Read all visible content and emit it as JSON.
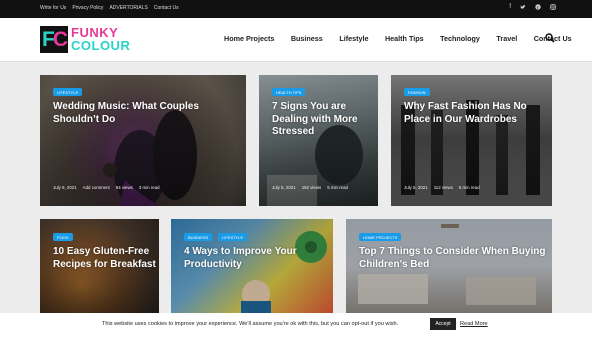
{
  "topbar": {
    "links": [
      "Write for Us",
      "Privacy Policy",
      "ADVERTORIALS",
      "Contact Us"
    ],
    "social_icons": [
      "facebook-icon",
      "twitter-icon",
      "pinterest-icon",
      "instagram-icon"
    ]
  },
  "logo": {
    "text": "FUNKY COLOUR"
  },
  "nav": {
    "items": [
      "Home Projects",
      "Business",
      "Lifestyle",
      "Health Tips",
      "Technology",
      "Travel",
      "Contact Us"
    ]
  },
  "cards": [
    {
      "category": "LIFESTYLE",
      "title": "Wedding Music: What Couples Shouldn’t Do",
      "date": "July 9, 2021",
      "comment": "Add comment",
      "views": "94 views",
      "read": "3 min read"
    },
    {
      "category": "HEALTH TIPS",
      "title": "7 Signs You are Dealing with More Stressed",
      "date": "July 5, 2021",
      "views": "182 views",
      "read": "5 min read"
    },
    {
      "category": "FASHION",
      "title": "Why Fast Fashion Has No Place in Our Wardrobes",
      "date": "July 5, 2021",
      "views": "112 views",
      "read": "5 min read"
    },
    {
      "category": "FOOD",
      "title": "10 Easy Gluten-Free Recipes for Breakfast"
    },
    {
      "category": "BUSINESS",
      "category2": "LIFESTYLE",
      "title": "4 Ways to Improve Your Productivity"
    },
    {
      "category": "HOME PROJECTS",
      "title": "Top 7 Things to Consider When Buying Children’s Bed"
    }
  ],
  "cookie": {
    "text": "This website uses cookies to improve your experience. We'll assume you're ok with this, but you can opt-out if you wish.",
    "accept_label": "Accept",
    "readmore_label": "Read More"
  }
}
